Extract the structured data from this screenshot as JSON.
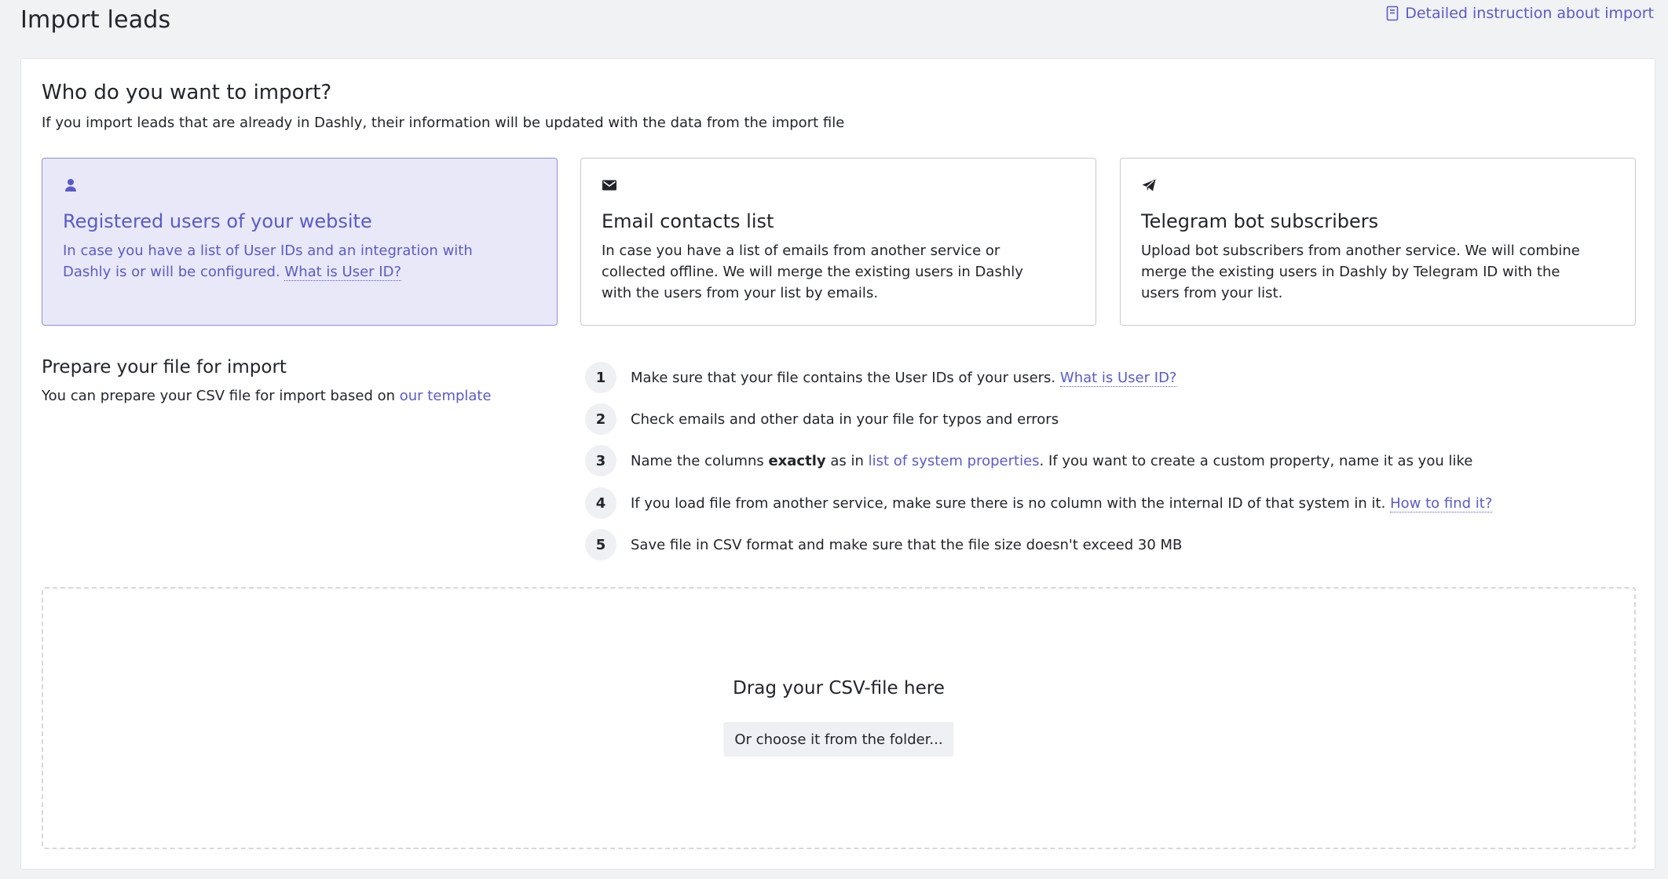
{
  "header": {
    "title": "Import leads",
    "instruction_link": "Detailed instruction about import"
  },
  "who": {
    "title": "Who do you want to import?",
    "subtitle": "If you import leads that are already in Dashly, their information will be updated with the data from the import file"
  },
  "options": [
    {
      "icon": "user-icon",
      "title": "Registered users of your website",
      "desc": "In case you have a list of User IDs and an integration with Dashly is or will be configured.",
      "link": "What is User ID?",
      "selected": true
    },
    {
      "icon": "envelope-icon",
      "title": "Email contacts list",
      "desc": "In case you have a list of emails from another service or collected offline. We will merge the existing users in Dashly with the users from your list by emails.",
      "selected": false
    },
    {
      "icon": "telegram-icon",
      "title": "Telegram bot subscribers",
      "desc": "Upload bot subscribers from another service. We will combine merge the existing users in Dashly by Telegram ID with the users from your list.",
      "selected": false
    }
  ],
  "prepare": {
    "title": "Prepare your file for import",
    "text": "You can prepare your CSV file for import based on",
    "link": "our template"
  },
  "steps": [
    {
      "num": "1",
      "text": "Make sure that your file contains the User IDs of your users.",
      "link": "What is User ID?"
    },
    {
      "num": "2",
      "text": "Check emails and other data in your file for typos and errors"
    },
    {
      "num": "3",
      "text_before": "Name the columns",
      "bold": "exactly",
      "text_mid": "as in",
      "link": "list of system properties",
      "text_after": ". If you want to create a custom property, name it as you like"
    },
    {
      "num": "4",
      "text": "If you load file from another service, make sure there is no column with the internal ID of that system in it.",
      "link": "How to find it?"
    },
    {
      "num": "5",
      "text": "Save file in CSV format and make sure that the file size doesn't exceed 30 MB"
    }
  ],
  "dropzone": {
    "title": "Drag your CSV-file here",
    "button": "Or choose it from the folder..."
  },
  "colors": {
    "accent": "#5a5bc9",
    "selected_bg": "#e9e8f9",
    "page_bg": "#f1f2f4"
  }
}
